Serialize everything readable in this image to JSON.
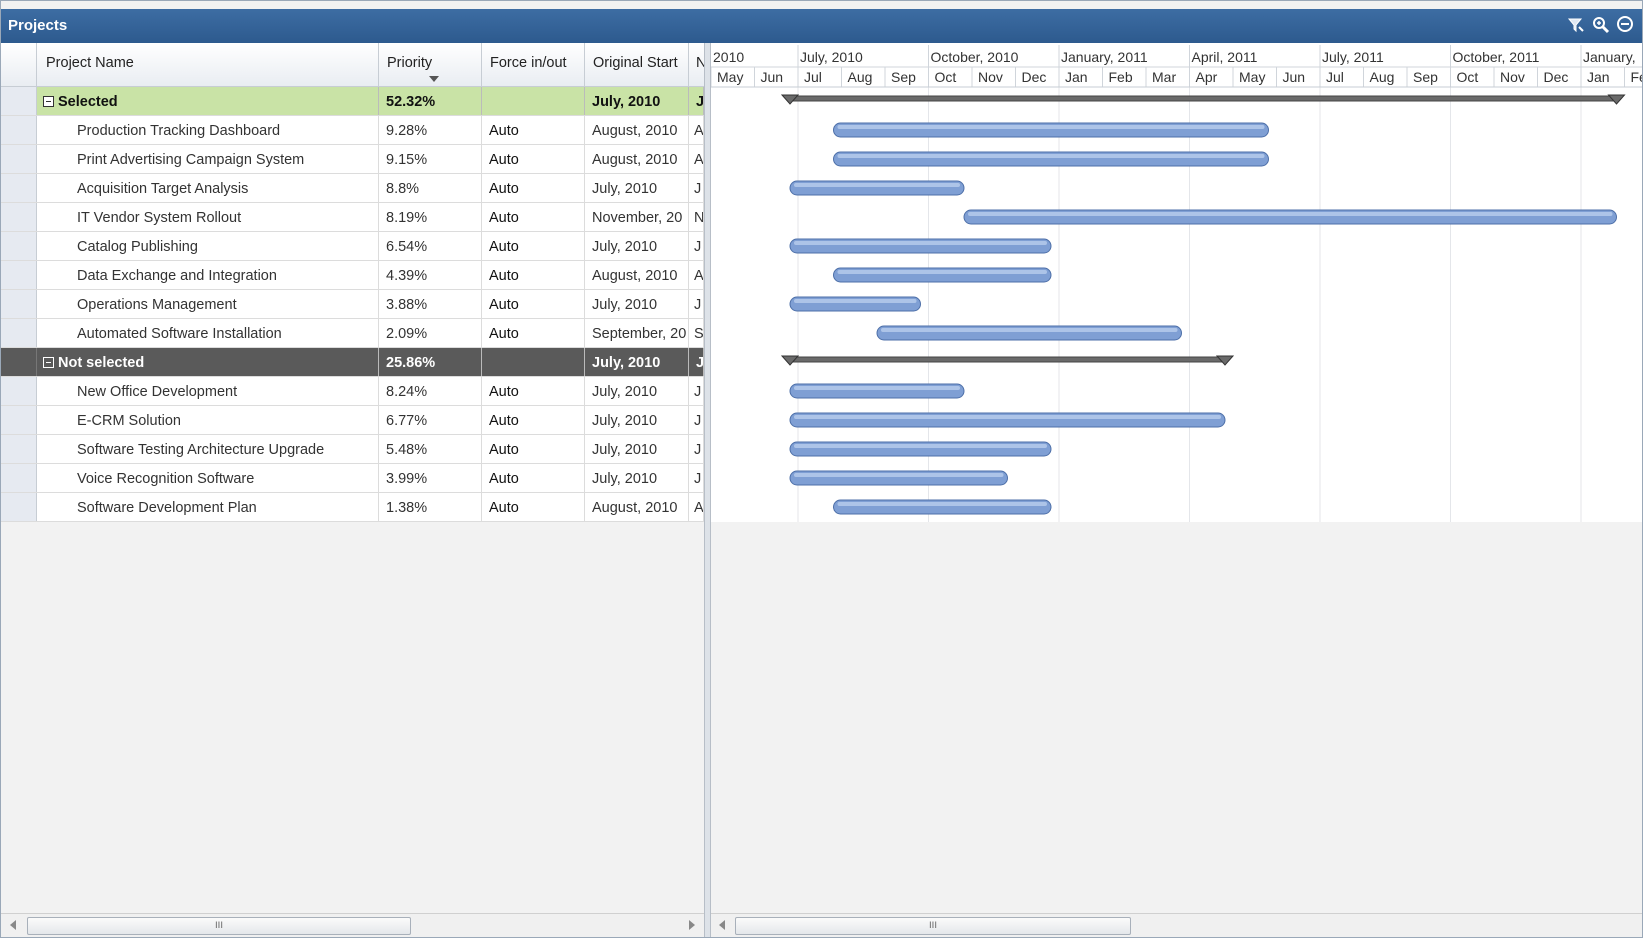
{
  "window": {
    "title": "Projects"
  },
  "toolbar_icons": [
    "filter-icon",
    "zoom-icon",
    "collapse-icon"
  ],
  "columns": {
    "name": "Project Name",
    "priority": "Priority",
    "force": "Force in/out",
    "start": "Original Start",
    "next": "N"
  },
  "groups": [
    {
      "label": "Selected",
      "priority": "52.32%",
      "start": "July, 2010",
      "next": "J",
      "summary": {
        "start": "2010-07-01",
        "end": "2012-02-01"
      },
      "projects": [
        {
          "name": "Production Tracking Dashboard",
          "priority": "9.28%",
          "force": "Auto",
          "start": "August, 2010",
          "next": "A",
          "bar_start": "2010-08-01",
          "bar_end": "2011-06-01"
        },
        {
          "name": "Print Advertising Campaign System",
          "priority": "9.15%",
          "force": "Auto",
          "start": "August, 2010",
          "next": "A",
          "bar_start": "2010-08-01",
          "bar_end": "2011-06-01"
        },
        {
          "name": "Acquisition Target Analysis",
          "priority": "8.8%",
          "force": "Auto",
          "start": "July, 2010",
          "next": "J",
          "bar_start": "2010-07-01",
          "bar_end": "2010-11-01"
        },
        {
          "name": "IT Vendor System Rollout",
          "priority": "8.19%",
          "force": "Auto",
          "start": "November, 20",
          "next": "N",
          "bar_start": "2010-11-01",
          "bar_end": "2012-02-01"
        },
        {
          "name": "Catalog Publishing",
          "priority": "6.54%",
          "force": "Auto",
          "start": "July, 2010",
          "next": "J",
          "bar_start": "2010-07-01",
          "bar_end": "2011-01-01"
        },
        {
          "name": "Data Exchange and Integration",
          "priority": "4.39%",
          "force": "Auto",
          "start": "August, 2010",
          "next": "A",
          "bar_start": "2010-08-01",
          "bar_end": "2011-01-01"
        },
        {
          "name": "Operations Management",
          "priority": "3.88%",
          "force": "Auto",
          "start": "July, 2010",
          "next": "J",
          "bar_start": "2010-07-01",
          "bar_end": "2010-10-01"
        },
        {
          "name": "Automated Software Installation",
          "priority": "2.09%",
          "force": "Auto",
          "start": "September, 20",
          "next": "S",
          "bar_start": "2010-09-01",
          "bar_end": "2011-04-01"
        }
      ]
    },
    {
      "label": "Not selected",
      "priority": "25.86%",
      "start": "July, 2010",
      "next": "J",
      "summary": {
        "start": "2010-07-01",
        "end": "2011-05-01"
      },
      "projects": [
        {
          "name": "New Office Development",
          "priority": "8.24%",
          "force": "Auto",
          "start": "July, 2010",
          "next": "J",
          "bar_start": "2010-07-01",
          "bar_end": "2010-11-01"
        },
        {
          "name": "E-CRM Solution",
          "priority": "6.77%",
          "force": "Auto",
          "start": "July, 2010",
          "next": "J",
          "bar_start": "2010-07-01",
          "bar_end": "2011-05-01"
        },
        {
          "name": "Software Testing Architecture Upgrade",
          "priority": "5.48%",
          "force": "Auto",
          "start": "July, 2010",
          "next": "J",
          "bar_start": "2010-07-01",
          "bar_end": "2011-01-01"
        },
        {
          "name": "Voice Recognition Software",
          "priority": "3.99%",
          "force": "Auto",
          "start": "July, 2010",
          "next": "J",
          "bar_start": "2010-07-01",
          "bar_end": "2010-12-01"
        },
        {
          "name": "Software Development Plan",
          "priority": "1.38%",
          "force": "Auto",
          "start": "August, 2010",
          "next": "A",
          "bar_start": "2010-08-01",
          "bar_end": "2011-01-01"
        }
      ]
    }
  ],
  "timeline": {
    "quarters": [
      "2010",
      "July, 2010",
      "October, 2010",
      "January, 2011",
      "April, 2011",
      "July, 2011",
      "October, 2011",
      "January,"
    ],
    "months": [
      "May",
      "Jun",
      "Jul",
      "Aug",
      "Sep",
      "Oct",
      "Nov",
      "Dec",
      "Jan",
      "Feb",
      "Mar",
      "Apr",
      "May",
      "Jun",
      "Jul",
      "Aug",
      "Sep",
      "Oct",
      "Nov",
      "Dec",
      "Jan",
      "Fe"
    ]
  },
  "scrollbars": {
    "grip": "III"
  },
  "colors": {
    "header": "#2d5a8e",
    "selected_group": "#c9e3a6",
    "not_selected_group": "#5a5a5a",
    "bar": "#7f9fd4"
  }
}
